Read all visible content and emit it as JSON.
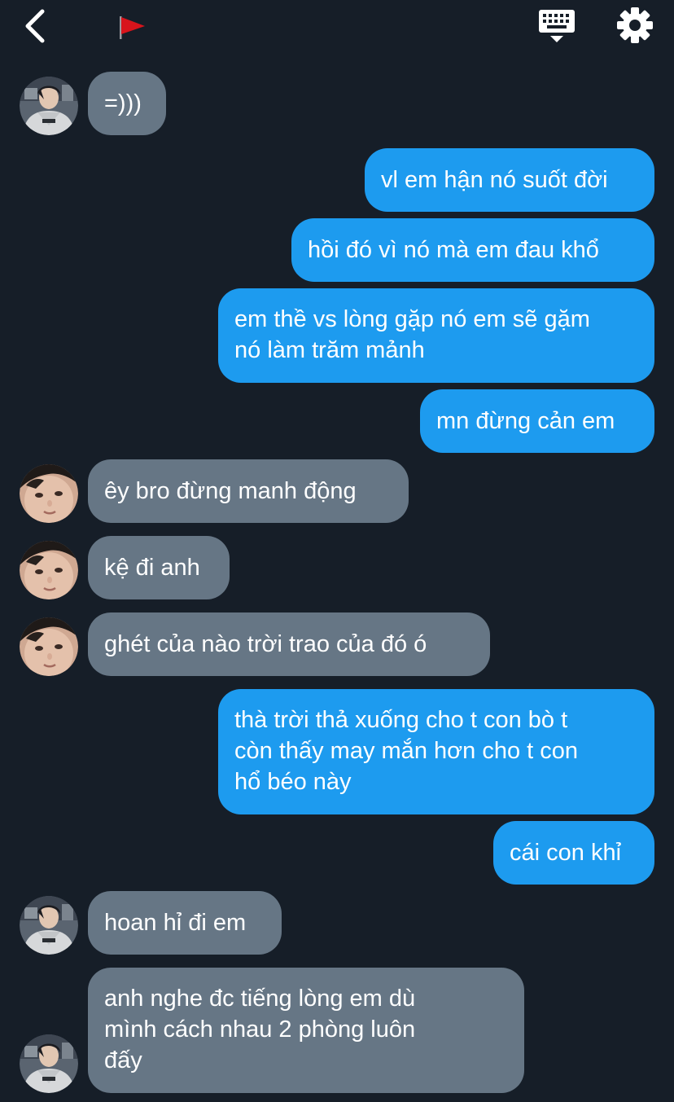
{
  "colors": {
    "background": "#161e28",
    "incoming_bubble": "#667685",
    "outgoing_bubble": "#1d9bef",
    "text": "#ffffff",
    "flag": "#d8141c"
  },
  "toolbar": {
    "back_icon": "chevron-left-icon",
    "flag_icon": "red-flag-icon",
    "keyboard_icon": "keyboard-icon",
    "settings_icon": "gear-icon"
  },
  "messages": [
    {
      "sender": "them",
      "avatar": "avatar-hoodie",
      "text": "=)))"
    },
    {
      "sender": "me",
      "text": "vl em hận nó suốt đời"
    },
    {
      "sender": "me",
      "text": "hồi đó vì nó mà em đau khổ"
    },
    {
      "sender": "me",
      "line1": "em thề vs lòng gặp nó em sẽ gặm",
      "line2": "nó làm trăm mảnh"
    },
    {
      "sender": "me",
      "text": "mn đừng cản em"
    },
    {
      "sender": "them",
      "avatar": "avatar-selfie",
      "text": "êy bro đừng manh động"
    },
    {
      "sender": "them",
      "avatar": "avatar-selfie",
      "text": "kệ đi anh"
    },
    {
      "sender": "them",
      "avatar": "avatar-selfie",
      "text": "ghét của nào trời trao của đó ó"
    },
    {
      "sender": "me",
      "line1": "thà trời thả xuống cho t con bò t",
      "line2": "còn thấy may mắn hơn cho t con",
      "line3": "hổ béo này"
    },
    {
      "sender": "me",
      "text": "cái con khỉ"
    },
    {
      "sender": "them",
      "avatar": "avatar-hoodie",
      "text": "hoan hỉ đi em"
    },
    {
      "sender": "them",
      "avatar": "avatar-hoodie",
      "line1": "anh nghe đc tiếng lòng em dù",
      "line2": "mình cách nhau 2 phòng luôn",
      "line3": "đấy"
    }
  ]
}
